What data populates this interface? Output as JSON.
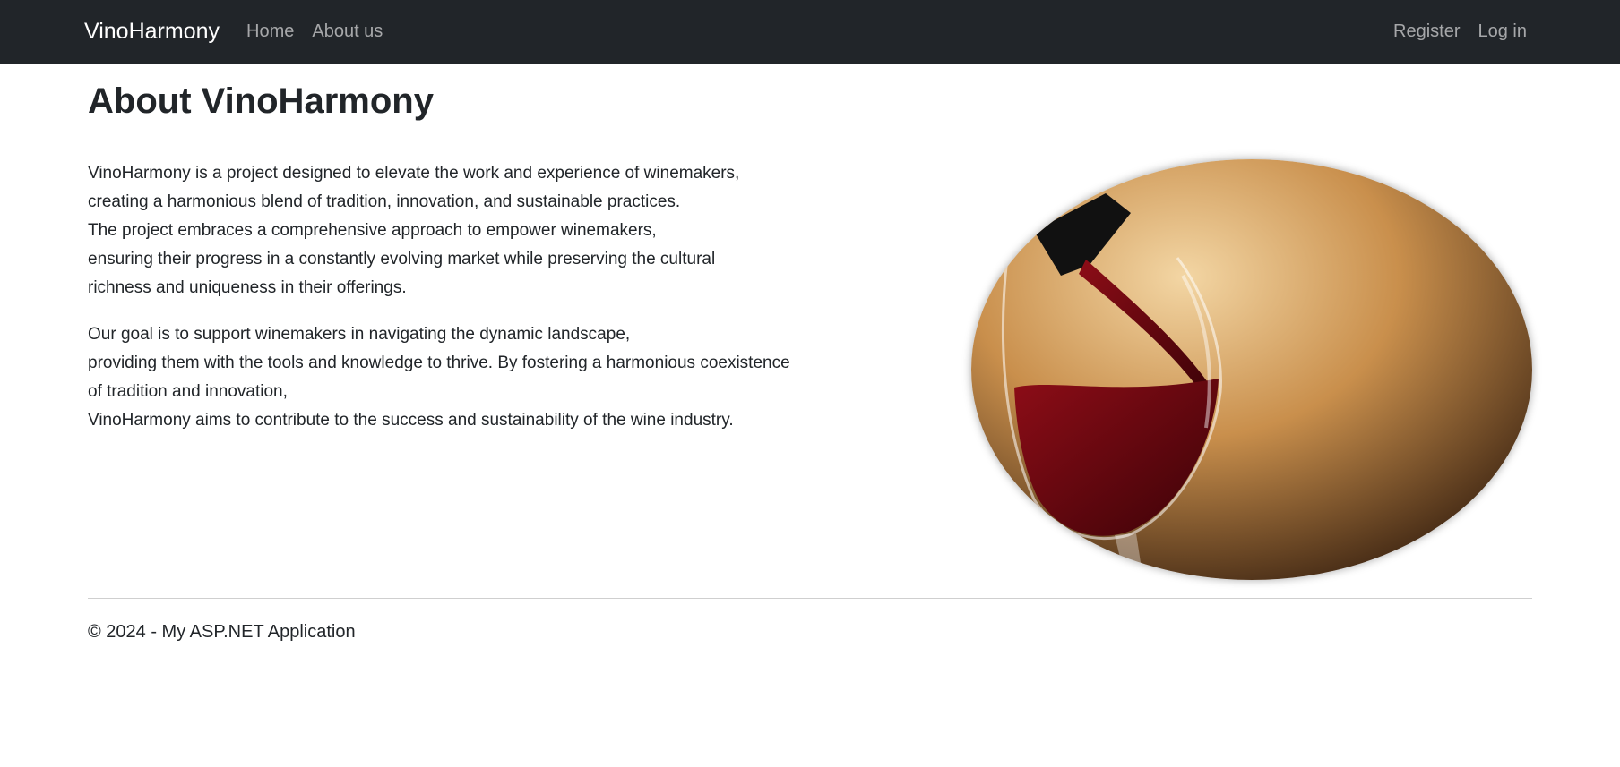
{
  "nav": {
    "brand": "VinoHarmony",
    "left_links": [
      "Home",
      "About us"
    ],
    "right_links": [
      "Register",
      "Log in"
    ]
  },
  "main": {
    "title": "About VinoHarmony",
    "paragraph1_lines": [
      "VinoHarmony is a project designed to elevate the work and experience of winemakers,",
      "creating a harmonious blend of tradition, innovation, and sustainable practices.",
      "The project embraces a comprehensive approach to empower winemakers,",
      "ensuring their progress in a constantly evolving market while preserving the cultural",
      "richness and uniqueness in their offerings."
    ],
    "paragraph2_lines": [
      "Our goal is to support winemakers in navigating the dynamic landscape,",
      "providing them with the tools and knowledge to thrive. By fostering a harmonious coexistence",
      "of tradition and innovation,",
      "VinoHarmony aims to contribute to the success and sustainability of the wine industry."
    ],
    "image": {
      "depicts": "red-wine-pouring-into-glass",
      "colors": {
        "background_light": "#f3d6a4",
        "background_mid": "#c98f4c",
        "background_dark": "#2a160a",
        "wine": "#8d0d17",
        "wine_dark": "#3b0207",
        "bottle": "#111111"
      }
    }
  },
  "footer": {
    "text": "© 2024 - My ASP.NET Application"
  },
  "colors": {
    "navbar_bg": "#212529",
    "brand": "#ffffff",
    "nav_link": "rgba(255,255,255,0.60)",
    "text": "#212529",
    "divider": "#cfcfcf"
  }
}
